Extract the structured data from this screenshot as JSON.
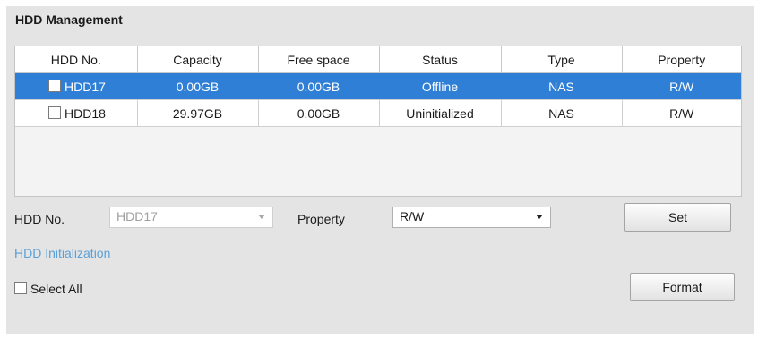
{
  "panel": {
    "title": "HDD Management"
  },
  "table": {
    "columns": [
      "HDD No.",
      "Capacity",
      "Free space",
      "Status",
      "Type",
      "Property"
    ],
    "rows": [
      {
        "hdd": "HDD17",
        "capacity": "0.00GB",
        "free": "0.00GB",
        "status": "Offline",
        "type": "NAS",
        "property": "R/W",
        "selected": true,
        "checked": false
      },
      {
        "hdd": "HDD18",
        "capacity": "29.97GB",
        "free": "0.00GB",
        "status": "Uninitialized",
        "type": "NAS",
        "property": "R/W",
        "selected": false,
        "checked": false
      }
    ]
  },
  "form": {
    "hdd_label": "HDD No.",
    "hdd_value": "HDD17",
    "property_label": "Property",
    "property_value": "R/W",
    "set_button": "Set",
    "init_link": "HDD Initialization",
    "select_all": "Select All",
    "format_button": "Format"
  },
  "colors": {
    "selected_row": "#2f7fd6",
    "link": "#5aa0d8",
    "panel_bg": "#e4e4e4"
  }
}
